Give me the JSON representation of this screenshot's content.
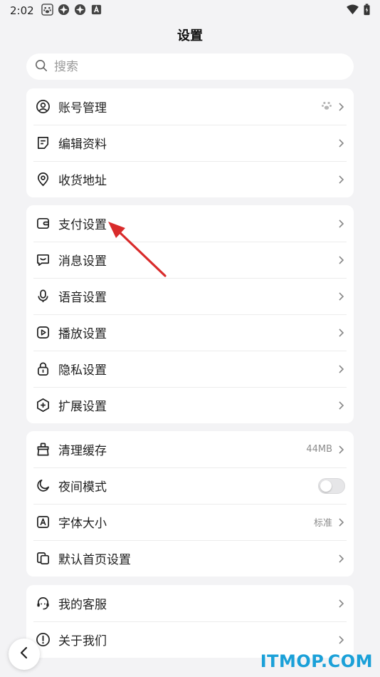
{
  "status_bar": {
    "time": "2:02",
    "left_icons": [
      "paw-icon",
      "app-icon",
      "app-icon",
      "a-icon"
    ],
    "right_icons": [
      "wifi-icon",
      "battery-icon"
    ]
  },
  "page": {
    "title": "设置"
  },
  "search": {
    "placeholder": "搜索",
    "value": ""
  },
  "groups": [
    {
      "items": [
        {
          "label": "账号管理",
          "icon": "account-icon",
          "right_icon": "paw-icon"
        },
        {
          "label": "编辑资料",
          "icon": "edit-profile-icon"
        },
        {
          "label": "收货地址",
          "icon": "location-pin-icon"
        }
      ]
    },
    {
      "items": [
        {
          "label": "支付设置",
          "icon": "wallet-icon"
        },
        {
          "label": "消息设置",
          "icon": "message-icon"
        },
        {
          "label": "语音设置",
          "icon": "microphone-icon"
        },
        {
          "label": "播放设置",
          "icon": "play-icon"
        },
        {
          "label": "隐私设置",
          "icon": "lock-icon"
        },
        {
          "label": "扩展设置",
          "icon": "extension-plus-icon"
        }
      ]
    },
    {
      "items": [
        {
          "label": "清理缓存",
          "icon": "broom-icon",
          "value": "44MB"
        },
        {
          "label": "夜间模式",
          "icon": "moon-icon",
          "toggle": false
        },
        {
          "label": "字体大小",
          "icon": "font-size-icon",
          "value": "标准"
        },
        {
          "label": "默认首页设置",
          "icon": "home-page-icon"
        }
      ]
    },
    {
      "items": [
        {
          "label": "我的客服",
          "icon": "customer-service-icon"
        },
        {
          "label": "关于我们",
          "icon": "info-icon"
        }
      ]
    }
  ],
  "annotation": {
    "arrow_color": "#d92b2b"
  },
  "watermark": {
    "text": "ITMOP.COM"
  },
  "colors": {
    "background": "#f3f3f5",
    "card": "#ffffff",
    "watermark": "#1aa0d8"
  }
}
